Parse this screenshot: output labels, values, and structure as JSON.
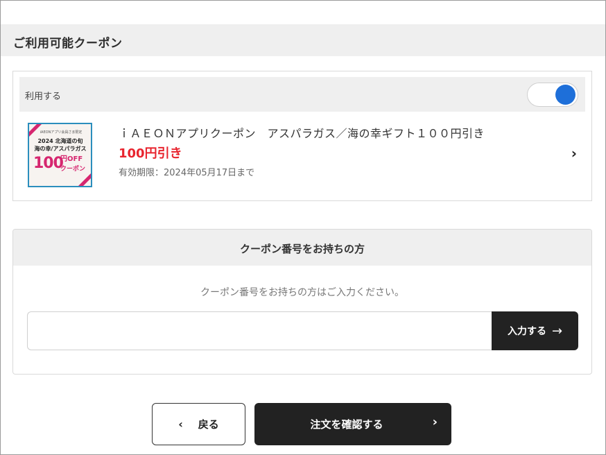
{
  "section": {
    "title": "ご利用可能クーポン"
  },
  "coupon_toggle": {
    "label": "利用する",
    "enabled": true,
    "color": "#1e6fd9"
  },
  "coupon": {
    "name": "ｉＡＥＯＮアプリクーポン　アスパラガス／海の幸ギフト１００円引き",
    "discount": "100円引き",
    "expiry": "有効期限：2024年05月17日まで",
    "discount_color": "#e8242e",
    "thumbnail": {
      "top_text": "iAEONアプリ会員さま限定",
      "line1": "2024 北海道の旬",
      "line2": "海の幸/アスパラガス",
      "big": "100",
      "off": "円OFF",
      "coupon_word": "クーポン"
    }
  },
  "coupon_code": {
    "title": "クーポン番号をお持ちの方",
    "hint": "クーポン番号をお持ちの方はご入力ください。",
    "input_value": "",
    "submit_label": "入力する"
  },
  "actions": {
    "back_label": "戻る",
    "confirm_label": "注文を確認する"
  }
}
